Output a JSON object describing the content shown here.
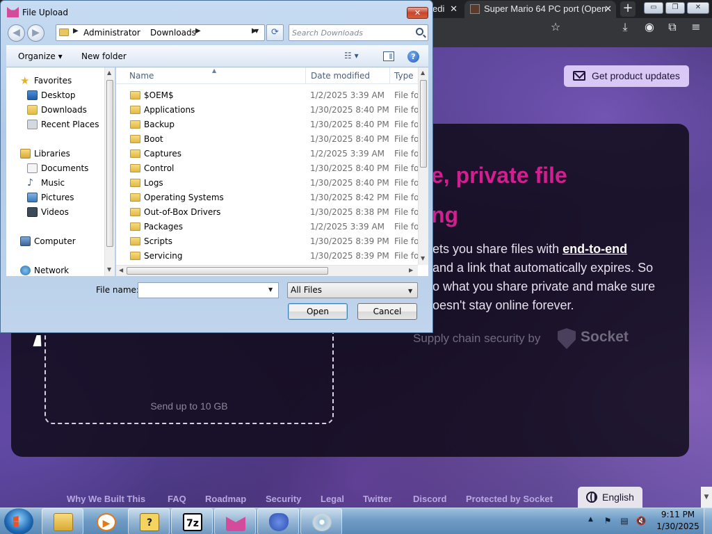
{
  "browser": {
    "tabs": [
      {
        "label": "edi"
      },
      {
        "label": "Super Mario 64 PC port (Open"
      }
    ],
    "new_tab_label": "+",
    "window_controls": {
      "minimize": "▭",
      "maximize": "❐",
      "close": "✕"
    },
    "toolbar_icons": [
      "bookmark-star-icon",
      "download-icon",
      "profile-icon",
      "extensions-icon",
      "menu-icon"
    ]
  },
  "site": {
    "product_updates_label": "Get product updates",
    "hero_title_line_1": "e, private file",
    "hero_title_line_2": "ng",
    "hero_line_1_prefix": "ets you share files with ",
    "hero_line_1_emphasis": "end-to-end",
    "hero_line_2": "and a link that automatically expires. So",
    "hero_line_3": "o what you share private and make sure",
    "hero_line_4": "oesn't stay online forever.",
    "supply_chain_text": "Supply chain security by",
    "supply_chain_brand": "Socket",
    "dropzone_label": "Send up to 10 GB",
    "footer_links": [
      "Why We Built This",
      "FAQ",
      "Roadmap",
      "Security",
      "Legal",
      "Twitter",
      "Discord",
      "Protected by Socket"
    ],
    "language_label": "English",
    "accent_color": "#d11f8f"
  },
  "dialog": {
    "title": "File Upload",
    "close_label": "✕",
    "breadcrumb": [
      "Administrator",
      "Downloads"
    ],
    "search_placeholder": "Search Downloads",
    "organize_label": "Organize ▾",
    "new_folder_label": "New folder",
    "help_label": "?",
    "nav": {
      "favorites": "Favorites",
      "favorites_items": [
        "Desktop",
        "Downloads",
        "Recent Places"
      ],
      "libraries": "Libraries",
      "libraries_items": [
        "Documents",
        "Music",
        "Pictures",
        "Videos"
      ],
      "computer": "Computer",
      "network": "Network"
    },
    "columns": {
      "name": "Name",
      "date_modified": "Date modified",
      "type": "Type"
    },
    "files": [
      {
        "name": "$OEM$",
        "date": "1/2/2025 3:39 AM",
        "type": "File fol"
      },
      {
        "name": "Applications",
        "date": "1/30/2025 8:40 PM",
        "type": "File fol"
      },
      {
        "name": "Backup",
        "date": "1/30/2025 8:40 PM",
        "type": "File fol"
      },
      {
        "name": "Boot",
        "date": "1/30/2025 8:40 PM",
        "type": "File fol"
      },
      {
        "name": "Captures",
        "date": "1/2/2025 3:39 AM",
        "type": "File fol"
      },
      {
        "name": "Control",
        "date": "1/30/2025 8:40 PM",
        "type": "File fol"
      },
      {
        "name": "Logs",
        "date": "1/30/2025 8:40 PM",
        "type": "File fol"
      },
      {
        "name": "Operating Systems",
        "date": "1/30/2025 8:42 PM",
        "type": "File fol"
      },
      {
        "name": "Out-of-Box Drivers",
        "date": "1/30/2025 8:38 PM",
        "type": "File fol"
      },
      {
        "name": "Packages",
        "date": "1/2/2025 3:39 AM",
        "type": "File fol"
      },
      {
        "name": "Scripts",
        "date": "1/30/2025 8:39 PM",
        "type": "File fol"
      },
      {
        "name": "Servicing",
        "date": "1/30/2025 8:39 PM",
        "type": "File fol"
      }
    ],
    "file_name_label": "File name:",
    "file_name_value": "",
    "file_type_value": "All Files",
    "open_label": "Open",
    "cancel_label": "Cancel"
  },
  "taskbar": {
    "apps": [
      {
        "name": "windows-explorer",
        "glyph": ""
      },
      {
        "name": "media-player",
        "glyph": "▶"
      },
      {
        "name": "help-support",
        "glyph": "?"
      },
      {
        "name": "7-zip",
        "glyph": "7z"
      },
      {
        "name": "firefox-send",
        "glyph": ""
      },
      {
        "name": "python",
        "glyph": ""
      },
      {
        "name": "disc-burner",
        "glyph": ""
      }
    ],
    "time": "9:11 PM",
    "date": "1/30/2025"
  }
}
